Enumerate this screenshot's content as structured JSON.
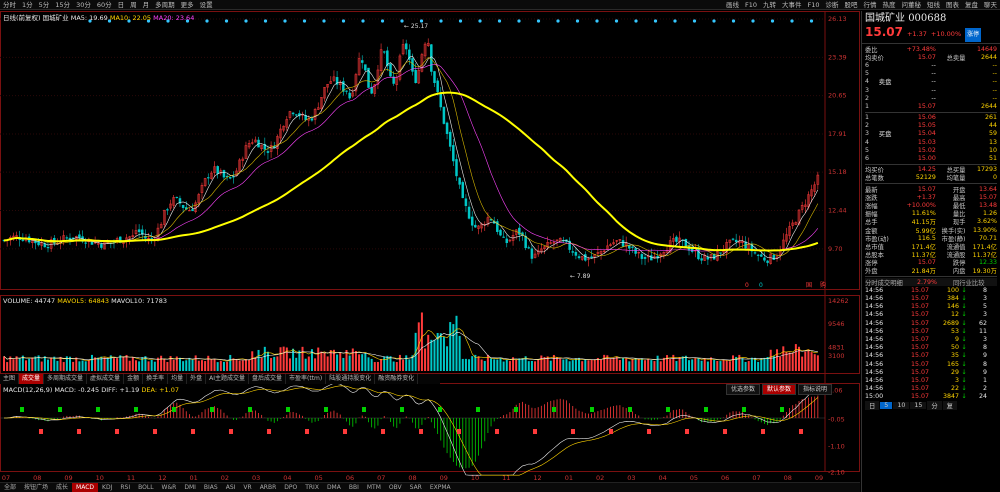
{
  "toolbar": {
    "left": [
      "分时",
      "1分",
      "5分",
      "15分",
      "30分",
      "60分",
      "日",
      "周",
      "月",
      "多周期",
      "更多",
      "设置"
    ],
    "right": [
      "画线",
      "F10",
      "九转",
      "大事件",
      "F10",
      "诊断",
      "股吧",
      "行情",
      "热度",
      "问董秘",
      "短线",
      "图表",
      "复盘",
      "聊天"
    ]
  },
  "legend": {
    "main_prefix": "日线(前复权) 国城矿业",
    "ma5": "MA5: 19.69",
    "ma10": "MA10: 22.05",
    "ma20": "MA20: 23.64",
    "volume": "VOLUME: 44747",
    "mavol5": "MAVOL5: 64843",
    "mavol10": "MAVOL10: 71783",
    "macd": "MACD(12,26,9) MACD: -0.245",
    "diff": "DIFF: +1.19",
    "dea": "DEA: +1.07"
  },
  "axes": {
    "price_ticks": [
      "26.13",
      "23.39",
      "20.65",
      "17.91",
      "15.18",
      "12.44",
      "9.70"
    ],
    "volume_ticks": [
      "14262",
      "9546",
      "4831",
      "3100"
    ],
    "macd_ticks": [
      "1.06",
      "-0.05",
      "-1.10",
      "-2.10"
    ],
    "date_ticks": [
      "07",
      "08",
      "09",
      "10",
      "11",
      "12",
      "01",
      "02",
      "03",
      "04",
      "05",
      "06",
      "07",
      "08",
      "09",
      "10",
      "11",
      "12",
      "01",
      "02",
      "03",
      "04",
      "05",
      "06",
      "07",
      "08",
      "09"
    ],
    "high_label": "25.17",
    "low_label": "7.89",
    "mark_labels": [
      "0",
      "0",
      "国",
      "购"
    ]
  },
  "indicator_tabs": [
    "主图",
    "成交量",
    "多周期成交量",
    "虚拟成交量",
    "金额",
    "换手率",
    "均量",
    "外盘",
    "AI主题成交量",
    "盘后成交量",
    "市盈率(ttm)",
    "陆股通持股变化",
    "融资融券变化"
  ],
  "indicator_active": 1,
  "macd_buttons": [
    "优选参数",
    "默认参数",
    "指标说明"
  ],
  "macd_button_active": 1,
  "bottom_tabs": [
    "全部",
    "按钮广场",
    "成长",
    "MACD",
    "KDJ",
    "RSI",
    "BOLL",
    "W&R",
    "DMI",
    "BIAS",
    "ASI",
    "VR",
    "ARBR",
    "DPO",
    "TRIX",
    "DMA",
    "BBI",
    "MTM",
    "OBV",
    "SAR",
    "EXPMA"
  ],
  "bottom_active": 3,
  "stock": {
    "name": "国城矿业",
    "code": "000688",
    "price": "15.07",
    "change": "+1.37",
    "pct": "+10.00%",
    "limit_tag": "涨停",
    "webi_label": "委比",
    "webi": "+73.48%",
    "weicha": "14649",
    "ask_avg_label": "均卖价",
    "ask_avg": "15.07",
    "ask_total_label": "总卖量",
    "ask_total": "2644",
    "asks": [
      {
        "l": "6",
        "p": "--",
        "v": "--"
      },
      {
        "l": "5",
        "p": "--",
        "v": "--"
      },
      {
        "l": "4",
        "p": "--",
        "v": "--"
      },
      {
        "l": "3",
        "p": "--",
        "v": "--"
      },
      {
        "l": "2",
        "p": "--",
        "v": "--"
      },
      {
        "l": "1",
        "p": "15.07",
        "v": "2644"
      }
    ],
    "ask_side": "卖盘",
    "bid_side": "买盘",
    "bids": [
      {
        "l": "1",
        "p": "15.06",
        "v": "261"
      },
      {
        "l": "2",
        "p": "15.05",
        "v": "44"
      },
      {
        "l": "3",
        "p": "15.04",
        "v": "59"
      },
      {
        "l": "4",
        "p": "15.03",
        "v": "13"
      },
      {
        "l": "5",
        "p": "15.02",
        "v": "10"
      },
      {
        "l": "6",
        "p": "15.00",
        "v": "51"
      }
    ],
    "bid_avg_label": "均买价",
    "bid_avg": "14.25",
    "bid_total_label": "总买量",
    "bid_total": "17293",
    "trade_count_label": "总笔数",
    "trade_count": "52129",
    "avg_vol_label": "均笔量",
    "avg_vol": "0",
    "stats": [
      [
        "最新",
        "15.07",
        "开盘",
        "13.64"
      ],
      [
        "涨跌",
        "+1.37",
        "最高",
        "15.07"
      ],
      [
        "涨幅",
        "+10.00%",
        "最低",
        "13.48"
      ],
      [
        "振幅",
        "11.61%",
        "量比",
        "1.26"
      ],
      [
        "总手",
        "41.15万",
        "现手",
        "3.62%"
      ],
      [
        "金额",
        "5.99亿",
        "换手(实)",
        "13.90%"
      ],
      [
        "市盈(动)",
        "116.5",
        "市盈(静)",
        "70.71"
      ],
      [
        "总市值",
        "171.4亿",
        "流通值",
        "171.4亿"
      ],
      [
        "总股本",
        "11.37亿",
        "流通股",
        "11.37亿"
      ],
      [
        "涨停",
        "15.07",
        "跌停",
        "12.33"
      ],
      [
        "外盘",
        "21.84万",
        "内盘",
        "19.30万"
      ]
    ],
    "tape_tabs": [
      "分时成交明细",
      "2.79%",
      "同行业比较"
    ],
    "ticks": [
      {
        "t": "14:56",
        "p": "15.07",
        "v": "100",
        "d": "↓",
        "n": "8"
      },
      {
        "t": "14:56",
        "p": "15.07",
        "v": "384",
        "d": "↓",
        "n": "3"
      },
      {
        "t": "14:56",
        "p": "15.07",
        "v": "146",
        "d": "↓",
        "n": "5"
      },
      {
        "t": "14:56",
        "p": "15.07",
        "v": "12",
        "d": "↓",
        "n": "3"
      },
      {
        "t": "14:56",
        "p": "15.07",
        "v": "2689",
        "d": "↓",
        "n": "62"
      },
      {
        "t": "14:56",
        "p": "15.07",
        "v": "53",
        "d": "↓",
        "n": "11"
      },
      {
        "t": "14:56",
        "p": "15.07",
        "v": "9",
        "d": "↓",
        "n": "3"
      },
      {
        "t": "14:56",
        "p": "15.07",
        "v": "50",
        "d": "↓",
        "n": "8"
      },
      {
        "t": "14:56",
        "p": "15.07",
        "v": "35",
        "d": "↓",
        "n": "9"
      },
      {
        "t": "14:56",
        "p": "15.07",
        "v": "165",
        "d": "↓",
        "n": "8"
      },
      {
        "t": "14:56",
        "p": "15.07",
        "v": "29",
        "d": "↓",
        "n": "9"
      },
      {
        "t": "14:56",
        "p": "15.07",
        "v": "3",
        "d": "↓",
        "n": "1"
      },
      {
        "t": "14:56",
        "p": "15.07",
        "v": "22",
        "d": "↓",
        "n": "2"
      },
      {
        "t": "15:00",
        "p": "15.07",
        "v": "3847",
        "d": "↓",
        "n": "24"
      }
    ],
    "bottom_bar": [
      "日",
      "5",
      "10",
      "15",
      "分",
      "复"
    ]
  }
}
